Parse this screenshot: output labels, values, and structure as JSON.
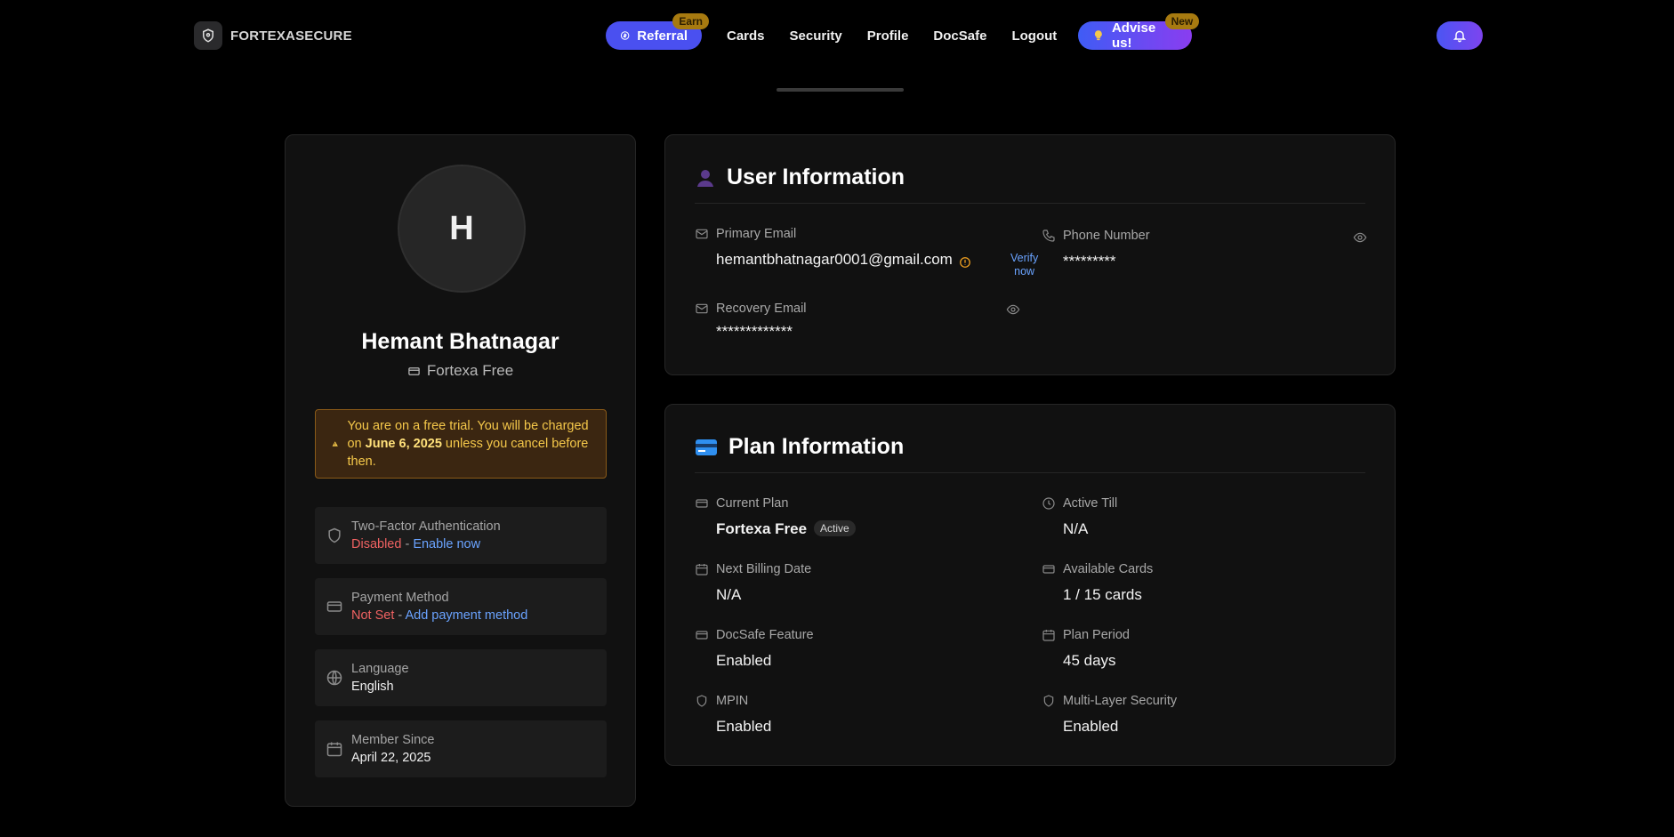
{
  "brand": {
    "name": "FORTEXASECURE"
  },
  "nav": {
    "referral": {
      "label": "Referral",
      "badge": "Earn"
    },
    "links": [
      "Cards",
      "Security",
      "Profile",
      "DocSafe",
      "Logout"
    ],
    "advise": {
      "label": "Advise us!",
      "badge": "New"
    }
  },
  "profile": {
    "initial": "H",
    "name": "Hemant Bhatnagar",
    "plan": "Fortexa Free",
    "trial": {
      "pre": "You are on a free trial. You will be charged on ",
      "date": "June 6, 2025",
      "post": " unless you cancel before then."
    },
    "two_factor": {
      "label": "Two-Factor Authentication",
      "status": "Disabled",
      "separator": " - ",
      "action": "Enable now"
    },
    "payment": {
      "label": "Payment Method",
      "status": "Not Set",
      "separator": " - ",
      "action": "Add payment method"
    },
    "language": {
      "label": "Language",
      "value": "English"
    },
    "member_since": {
      "label": "Member Since",
      "value": "April 22, 2025"
    }
  },
  "user_info": {
    "title": "User Information",
    "primary_email": {
      "label": "Primary Email",
      "value": "hemantbhatnagar0001@gmail.com",
      "verify_line1": "Verify",
      "verify_line2": "now"
    },
    "phone": {
      "label": "Phone Number",
      "value": "*********"
    },
    "recovery_email": {
      "label": "Recovery Email",
      "value": "*************"
    }
  },
  "plan_info": {
    "title": "Plan Information",
    "current_plan": {
      "label": "Current Plan",
      "value": "Fortexa Free",
      "badge": "Active"
    },
    "active_till": {
      "label": "Active Till",
      "value": "N/A"
    },
    "next_billing": {
      "label": "Next Billing Date",
      "value": "N/A"
    },
    "available_cards": {
      "label": "Available Cards",
      "value": "1 / 15 cards"
    },
    "docsafe": {
      "label": "DocSafe Feature",
      "value": "Enabled"
    },
    "plan_period": {
      "label": "Plan Period",
      "value": "45 days"
    },
    "mpin": {
      "label": "MPIN",
      "value": "Enabled"
    },
    "multi_layer": {
      "label": "Multi-Layer Security",
      "value": "Enabled"
    }
  },
  "colors": {
    "accent": "#4a50f0",
    "danger": "#f06262",
    "link": "#6aa3ff",
    "warning": "#f5c84a"
  }
}
